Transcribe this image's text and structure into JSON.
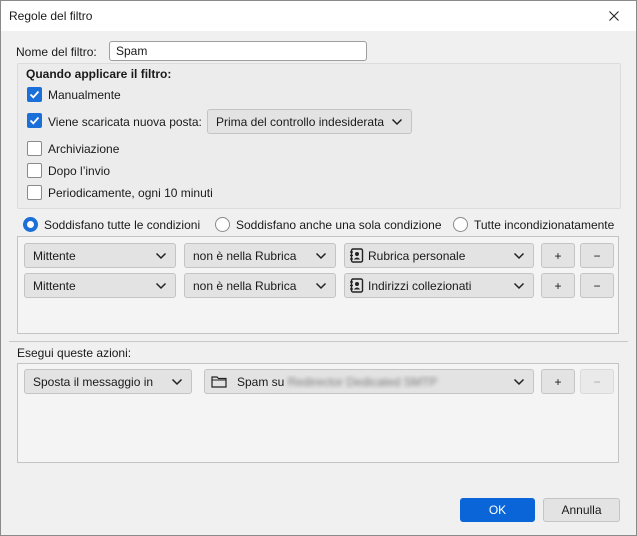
{
  "window": {
    "title": "Regole del filtro"
  },
  "filter_name": {
    "label": "Nome del filtro:",
    "value": "Spam"
  },
  "when": {
    "title": "Quando applicare il filtro:",
    "manual": {
      "label": "Manualmente",
      "checked": true
    },
    "new_mail": {
      "label": "Viene scaricata nuova posta:",
      "checked": true,
      "option": "Prima del controllo indesiderata"
    },
    "archive": {
      "label": "Archiviazione",
      "checked": false
    },
    "after_send": {
      "label": "Dopo l’invio",
      "checked": false
    },
    "periodic": {
      "label": "Periodicamente, ogni 10 minuti",
      "checked": false
    }
  },
  "match": {
    "all": {
      "label": "Soddisfano tutte le condizioni",
      "selected": true
    },
    "any": {
      "label": "Soddisfano anche una sola condizione",
      "selected": false
    },
    "unconditional": {
      "label": "Tutte incondizionatamente",
      "selected": false
    }
  },
  "conditions": [
    {
      "field": "Mittente",
      "operator": "non è nella Rubrica",
      "value": "Rubrica personale",
      "value_icon": "address-book-icon",
      "add": "+",
      "remove": "−"
    },
    {
      "field": "Mittente",
      "operator": "non è nella Rubrica",
      "value": "Indirizzi collezionati",
      "value_icon": "address-book-icon",
      "add": "+",
      "remove": "−"
    }
  ],
  "actions": {
    "label": "Esegui queste azioni:",
    "items": [
      {
        "action": "Sposta il messaggio in",
        "target_prefix": "Spam su",
        "target_account": "Redirector Dedicated SMTP",
        "target_icon": "folder-icon",
        "add": "+",
        "remove": "−"
      }
    ]
  },
  "buttons": {
    "ok": "OK",
    "cancel": "Annulla"
  },
  "colors": {
    "accent": "#1a6fd8",
    "ok_button": "#0a66d8"
  }
}
